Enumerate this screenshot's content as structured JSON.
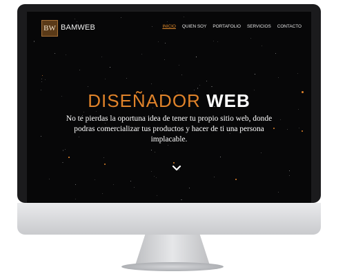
{
  "site": {
    "logo_text": "BW",
    "brand": "BAMWEB",
    "nav": [
      {
        "label": "INICIO",
        "active": true
      },
      {
        "label": "QUIEN SOY",
        "active": false
      },
      {
        "label": "PORTAFOLIO",
        "active": false
      },
      {
        "label": "SERVICIOS",
        "active": false
      },
      {
        "label": "CONTACTO",
        "active": false
      }
    ]
  },
  "hero": {
    "title_part1": "DISEÑADOR",
    "title_part2": "WEB",
    "text": "No te pierdas la oportuna idea de tener tu propio sitio web, donde podras comercializar tus productos y hacer de ti una persona implacable."
  },
  "icons": {
    "scroll": "chevron-down-icon"
  },
  "colors": {
    "accent": "#e0832a",
    "screen_bg": "#070708",
    "bezel": "#1b1b1d",
    "chin": "#d9dadc"
  }
}
